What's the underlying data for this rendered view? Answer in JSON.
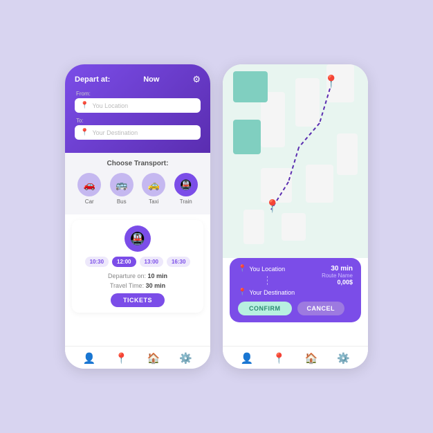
{
  "background": "#d8d4f0",
  "accent": "#7b4de8",
  "left_phone": {
    "header": {
      "depart_label": "Depart at:",
      "depart_value": "Now",
      "from_label": "From:",
      "from_placeholder": "You Location",
      "to_label": "To:",
      "to_placeholder": "Your Destination"
    },
    "transport": {
      "section_label": "Choose Transport:",
      "items": [
        {
          "name": "Car",
          "icon": "🚗",
          "active": false
        },
        {
          "name": "Bus",
          "icon": "🚌",
          "active": false
        },
        {
          "name": "Taxi",
          "icon": "🚕",
          "active": false
        },
        {
          "name": "Train",
          "icon": "🚇",
          "active": true
        }
      ]
    },
    "schedule": {
      "times": [
        {
          "time": "10:30",
          "active": false
        },
        {
          "time": "12:00",
          "active": true
        },
        {
          "time": "13:00",
          "active": false
        },
        {
          "time": "16:30",
          "active": false
        }
      ],
      "departure_label": "Departure on:",
      "departure_value": "10 min",
      "travel_label": "Travel Time:",
      "travel_value": "30 min",
      "tickets_label": "TICKETS"
    },
    "bottom_nav": [
      "👤",
      "📍",
      "🏠",
      "⚙️"
    ]
  },
  "right_phone": {
    "map": {
      "pin_top_label": "destination pin",
      "pin_bottom_label": "location pin"
    },
    "info_card": {
      "from": "You Location",
      "to": "Your Destination",
      "route_time": "30 min",
      "route_name": "Route Name",
      "route_price": "0,00$",
      "confirm_label": "CONFIRM",
      "cancel_label": "CANCEL"
    },
    "bottom_nav": [
      "👤",
      "📍",
      "🏠",
      "⚙️"
    ]
  }
}
